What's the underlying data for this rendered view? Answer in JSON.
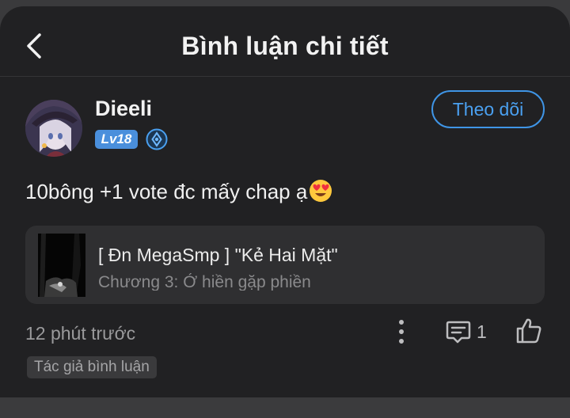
{
  "header": {
    "title": "Bình luận chi tiết"
  },
  "comment": {
    "username": "Dieeli",
    "level": "Lv18",
    "follow_label": "Theo dõi",
    "text": "10bông +1 vote đc mấy chap ạ",
    "emoji": "heart-eyes-emoji",
    "timestamp": "12 phút trước",
    "comment_count": "1",
    "author_tag": "Tác giả bình luận"
  },
  "story": {
    "title": "[ Đn MegaSmp ] \"Kẻ Hai Mặt\"",
    "chapter": "Chương 3: Ở hiền gặp phiền"
  },
  "colors": {
    "background": "#212123",
    "accent": "#4aa0f0",
    "level_badge": "#4a8fdc"
  },
  "icons": [
    "back-arrow-icon",
    "rank-icon",
    "more-vertical-icon",
    "comment-icon",
    "thumbs-up-icon"
  ]
}
